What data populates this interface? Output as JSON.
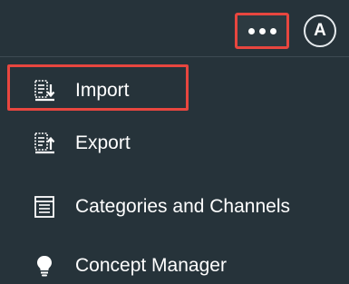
{
  "topbar": {
    "more_icon": "ellipsis-icon",
    "avatar_initial": "A"
  },
  "menu": {
    "items": [
      {
        "label": "Import",
        "icon": "import-icon"
      },
      {
        "label": "Export",
        "icon": "export-icon"
      },
      {
        "label": "Categories and Channels",
        "icon": "list-document-icon"
      },
      {
        "label": "Concept Manager",
        "icon": "lightbulb-icon"
      }
    ]
  },
  "colors": {
    "background": "#26333a",
    "highlight": "#e8463f",
    "text": "#ffffff"
  }
}
